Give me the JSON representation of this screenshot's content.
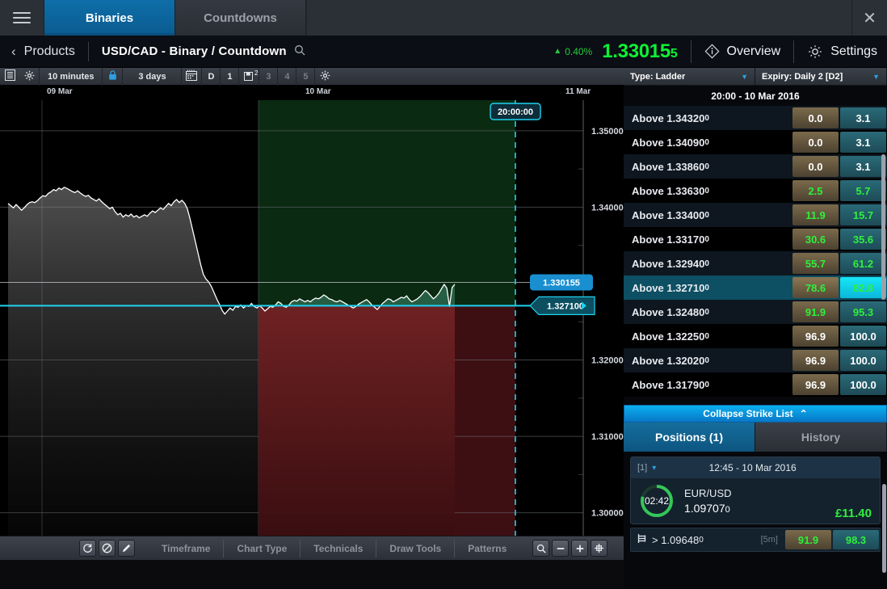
{
  "titlebar": {
    "menu_icon": "hamburger-icon",
    "tabs": [
      {
        "label": "Binaries",
        "active": true
      },
      {
        "label": "Countdowns",
        "active": false
      }
    ],
    "close_label": "✕"
  },
  "productbar": {
    "back_label": "‹",
    "products_label": "Products",
    "symbol": "USD/CAD - Binary / Countdown",
    "search_icon": "search-icon",
    "change_arrow": "▲",
    "change_pct": "0.40%",
    "price_main": "1.33015",
    "price_sub": "5",
    "overview_label": "Overview",
    "settings_label": "Settings",
    "price_color": "#0cf235"
  },
  "chart_toolbar": {
    "list_icon": "list-icon",
    "gear_icon_left": "gear-icon",
    "interval": "10 minutes",
    "lock_icon": "lock-icon",
    "range": "3 days",
    "calendar_icon": "calendar-icon",
    "d_label": "D",
    "numbers": [
      "1",
      "2",
      "3",
      "4",
      "5"
    ],
    "active_number": "2",
    "gear_icon_right": "gear-icon"
  },
  "bottom_toolbar": {
    "icons": [
      "refresh-icon",
      "no-entry-icon",
      "pencil-icon"
    ],
    "menu": [
      "Timeframe",
      "Chart Type",
      "Technicals",
      "Draw Tools",
      "Patterns"
    ],
    "right_icons": [
      "magnifier-icon",
      "zoom-out-icon",
      "zoom-in-icon",
      "crosshair-icon"
    ]
  },
  "chart_data": {
    "type": "line",
    "title": "USD/CAD - Binary / Countdown",
    "xlabel": "",
    "ylabel": "",
    "date_labels": [
      "09 Mar",
      "10 Mar",
      "11 Mar"
    ],
    "y_ticks": [
      "1.35000",
      "1.34000",
      "1.32000",
      "1.31000",
      "1.30000"
    ],
    "ylim": [
      1.297,
      1.354
    ],
    "current_price_tag": "1.330155",
    "strike_line_tag": "1.327100",
    "expiry_time_tag": "20:00:00",
    "grid": true,
    "line_color": "#ffffff",
    "strike_color": "#1fd2f0",
    "above_zone_color": "#0a2a12",
    "below_zone_color": "#55131a",
    "series": [
      {
        "name": "USD/CAD",
        "values": [
          1.3405,
          1.3402,
          1.3399,
          1.34035,
          1.34,
          1.3396,
          1.3399,
          1.3403,
          1.3406,
          1.3407,
          1.3406,
          1.34085,
          1.3412,
          1.3415,
          1.3414,
          1.3418,
          1.342,
          1.3423,
          1.34215,
          1.3425,
          1.3423,
          1.3426,
          1.34245,
          1.34225,
          1.34205,
          1.3419,
          1.34215,
          1.34185,
          1.3416,
          1.3414,
          1.34155,
          1.3412,
          1.341,
          1.3408,
          1.3411,
          1.3407,
          1.3404,
          1.3401,
          1.3398,
          1.34,
          1.3394,
          1.339,
          1.3392,
          1.3387,
          1.339,
          1.3388,
          1.3391,
          1.3387,
          1.3389,
          1.3386,
          1.3388,
          1.339,
          1.3388,
          1.3392,
          1.3395,
          1.3393,
          1.3396,
          1.3399,
          1.3397,
          1.3401,
          1.3405,
          1.3402,
          1.3407,
          1.341,
          1.3406,
          1.3409,
          1.3405,
          1.3398,
          1.3385,
          1.337,
          1.3355,
          1.334,
          1.3325,
          1.3312,
          1.3306,
          1.3302,
          1.3296,
          1.3288,
          1.328,
          1.3273,
          1.3265,
          1.326,
          1.3264,
          1.3268,
          1.3265,
          1.327,
          1.3269,
          1.3272,
          1.3268,
          1.3271,
          1.327,
          1.3274,
          1.327,
          1.3268,
          1.3271,
          1.3268,
          1.3264,
          1.3267,
          1.327,
          1.3269,
          1.3272,
          1.3276,
          1.3274,
          1.327,
          1.3269,
          1.3272,
          1.3276,
          1.3278,
          1.3277,
          1.328,
          1.3278,
          1.3276,
          1.3278,
          1.3276,
          1.3279,
          1.3281,
          1.328,
          1.3282,
          1.3285,
          1.3283,
          1.328,
          1.3279,
          1.3277,
          1.3276,
          1.3278,
          1.3276,
          1.3274,
          1.3272,
          1.327,
          1.3268,
          1.327,
          1.3273,
          1.3275,
          1.3277,
          1.3279,
          1.3276,
          1.3272,
          1.3269,
          1.3266,
          1.327,
          1.3274,
          1.3277,
          1.328,
          1.3279,
          1.3276,
          1.3278,
          1.328,
          1.3282,
          1.3281,
          1.3284,
          1.3279,
          1.3276,
          1.3278,
          1.328,
          1.3283,
          1.3287,
          1.3291,
          1.3288,
          1.3284,
          1.328,
          1.3283,
          1.3287,
          1.3293,
          1.3299,
          1.3294,
          1.327,
          1.3295,
          1.3299
        ]
      }
    ]
  },
  "right_panel": {
    "type_select": "Type: Ladder",
    "expiry_select": "Expiry: Daily 2 [D2]",
    "expiry_title": "20:00 - 10 Mar 2016",
    "strike_rows": [
      {
        "label": "Above 1.34320",
        "label_sub": "0",
        "sell": "0.0",
        "buy": "3.1",
        "green": false,
        "selected": false
      },
      {
        "label": "Above 1.34090",
        "label_sub": "0",
        "sell": "0.0",
        "buy": "3.1",
        "green": false,
        "selected": false
      },
      {
        "label": "Above 1.33860",
        "label_sub": "0",
        "sell": "0.0",
        "buy": "3.1",
        "green": false,
        "selected": false
      },
      {
        "label": "Above 1.33630",
        "label_sub": "0",
        "sell": "2.5",
        "buy": "5.7",
        "green": true,
        "selected": false
      },
      {
        "label": "Above 1.33400",
        "label_sub": "0",
        "sell": "11.9",
        "buy": "15.7",
        "green": true,
        "selected": false
      },
      {
        "label": "Above 1.33170",
        "label_sub": "0",
        "sell": "30.6",
        "buy": "35.6",
        "green": true,
        "selected": false
      },
      {
        "label": "Above 1.32940",
        "label_sub": "0",
        "sell": "55.7",
        "buy": "61.2",
        "green": true,
        "selected": false
      },
      {
        "label": "Above 1.32710",
        "label_sub": "0",
        "sell": "78.6",
        "buy": "82.8",
        "green": true,
        "selected": true
      },
      {
        "label": "Above 1.32480",
        "label_sub": "0",
        "sell": "91.9",
        "buy": "95.3",
        "green": true,
        "selected": false
      },
      {
        "label": "Above 1.32250",
        "label_sub": "0",
        "sell": "96.9",
        "buy": "100.0",
        "green": false,
        "selected": false
      },
      {
        "label": "Above 1.32020",
        "label_sub": "0",
        "sell": "96.9",
        "buy": "100.0",
        "green": false,
        "selected": false
      },
      {
        "label": "Above 1.31790",
        "label_sub": "0",
        "sell": "96.9",
        "buy": "100.0",
        "green": false,
        "selected": false
      }
    ],
    "collapse_label": "Collapse Strike List",
    "collapse_chevron": "⌃",
    "position_tabs": [
      {
        "label": "Positions (1)",
        "active": true
      },
      {
        "label": "History",
        "active": false
      }
    ],
    "position": {
      "index": "[1]",
      "chevron": "▾",
      "date": "12:45 - 10 Mar 2016",
      "timer": "02:42",
      "pair": "EUR/USD",
      "price": "1.09707",
      "price_sub": "0",
      "pnl": "£11.40",
      "row_icon": "ladder-icon",
      "row_label": "> 1.09648",
      "row_label_sub": "0",
      "timeframe": "[5m]",
      "sell": "91.9",
      "buy": "98.3"
    }
  }
}
